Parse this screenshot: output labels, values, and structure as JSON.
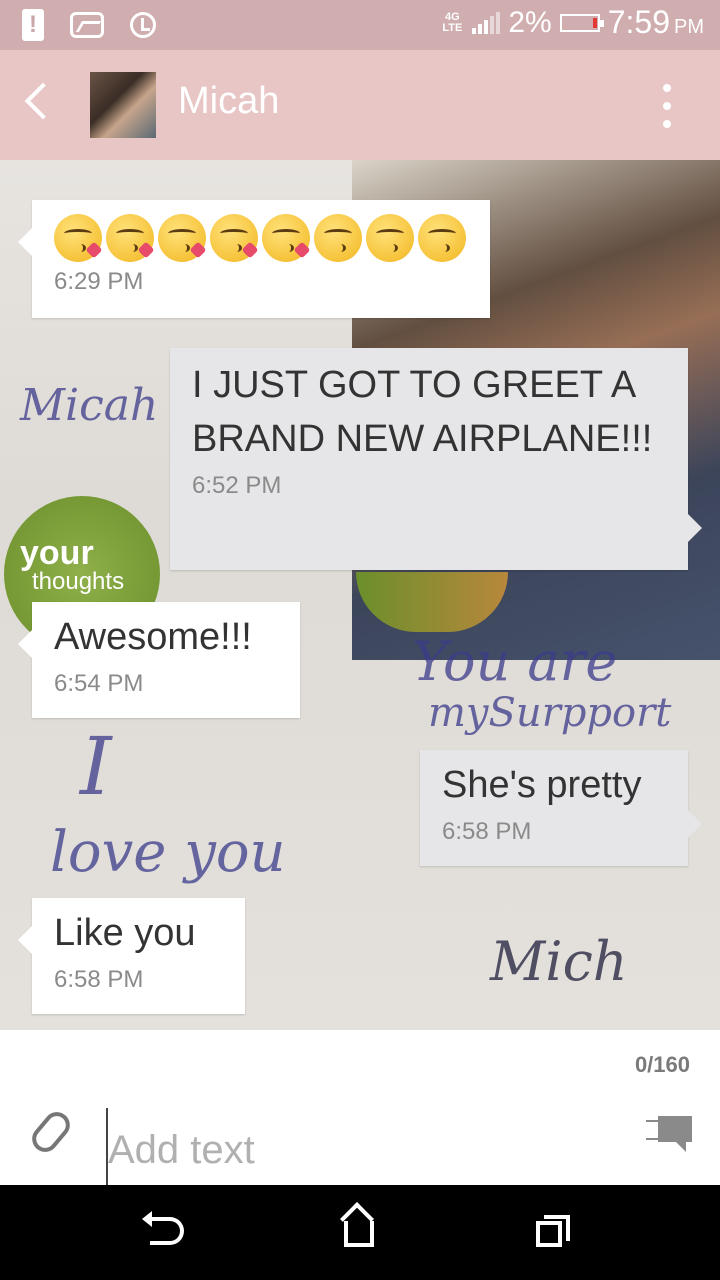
{
  "status_bar": {
    "network": "4G",
    "network_sub": "LTE",
    "battery_percent": "2%",
    "time": "7:59",
    "ampm": "PM"
  },
  "header": {
    "contact_name": "Micah"
  },
  "messages": [
    {
      "direction": "incoming",
      "type": "emoji",
      "emojis": [
        "kissing-heart",
        "kissing-heart",
        "kissing-heart",
        "kissing-heart",
        "kissing-heart",
        "kissing-closed-eyes",
        "kissing-closed-eyes",
        "kissing-closed-eyes"
      ],
      "time": "6:29 PM"
    },
    {
      "direction": "outgoing",
      "text": "I JUST GOT TO GREET A BRAND NEW AIRPLANE!!!",
      "time": "6:52 PM"
    },
    {
      "direction": "incoming",
      "text": "Awesome!!!",
      "time": "6:54 PM"
    },
    {
      "direction": "outgoing",
      "text": "She's pretty",
      "time": "6:58 PM"
    },
    {
      "direction": "incoming",
      "text": "Like you",
      "time": "6:58 PM"
    }
  ],
  "background_text": {
    "micah": "Micah",
    "your": "your",
    "thoughts": "thoughts",
    "you_are": "You are",
    "my_support": "mySurpport",
    "i": "I",
    "love_you": "love you",
    "signature": "Mich"
  },
  "composer": {
    "counter": "0/160",
    "placeholder": "Add text"
  },
  "colors": {
    "header": "#e8c6c6",
    "status_bar": "#d0aeb0",
    "incoming_bubble": "#ffffff",
    "outgoing_bubble": "#e6e6e8"
  }
}
